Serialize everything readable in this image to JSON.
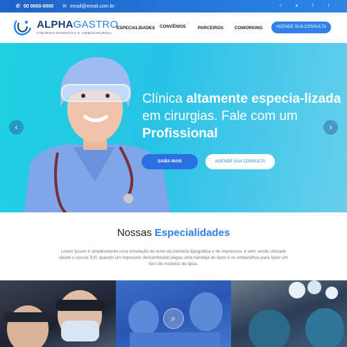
{
  "topbar": {
    "phone": "00 0000-0000",
    "email": "email@email.com.br",
    "icons": [
      "search-icon",
      "user-icon",
      "facebook-icon",
      "twitter-icon"
    ]
  },
  "header": {
    "logo_brand_bold": "ALPHA",
    "logo_brand_light": "GASTRO",
    "logo_subtitle": "CIRURGIA DIGESTIVA E VIDEOCIRURGIA",
    "nav": [
      "ESPECIALIDADES",
      "CONVÊNIOS",
      "PARCEIROS",
      "COWORKING"
    ],
    "cta": "AGENDE SUA CONSULTA"
  },
  "hero": {
    "headline_1": "Clínica ",
    "headline_2": "altamente especia-lizada",
    "headline_3": " em cirurgias. Fale com um ",
    "headline_4": "Profissional",
    "button_more": "SAIBA MAIS",
    "button_appointment": "AGENDE SUA CONSULTA",
    "prev_label": "‹",
    "next_label": "›"
  },
  "specialties": {
    "title_plain": "Nossas ",
    "title_highlight": "Especialidades",
    "description": "Lorem Ipsum é simplesmente uma simulação de texto da indústria tipográfica e de impressos, e vem sendo utilizado desde o século XVI, quando um impressor desconhecido pegou uma bandeja de tipos e os embaralhou para fazer um livro de modelos de tipos."
  },
  "colors": {
    "primary": "#2f80ea",
    "hero_cyan": "#28c3e6",
    "topbar": "#1e63c9"
  }
}
